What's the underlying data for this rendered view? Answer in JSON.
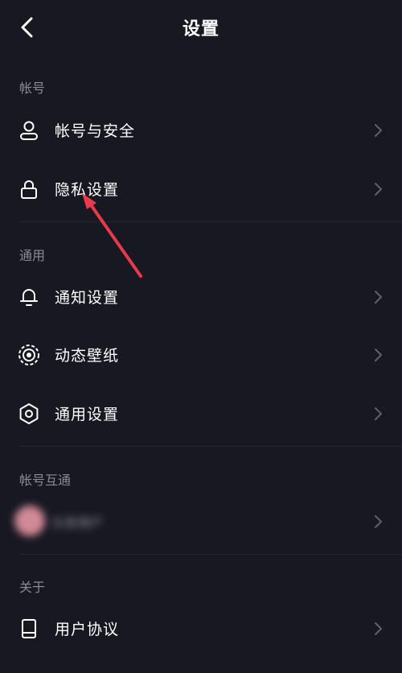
{
  "header": {
    "title": "设置",
    "back_icon": "chevron-left-icon"
  },
  "sections": {
    "account": {
      "label": "帐号",
      "items": [
        {
          "label": "帐号与安全",
          "icon": "user-icon"
        },
        {
          "label": "隐私设置",
          "icon": "lock-icon"
        }
      ]
    },
    "general": {
      "label": "通用",
      "items": [
        {
          "label": "通知设置",
          "icon": "bell-icon"
        },
        {
          "label": "动态壁纸",
          "icon": "live-wallpaper-icon"
        },
        {
          "label": "通用设置",
          "icon": "gear-icon"
        }
      ]
    },
    "linked": {
      "label": "帐号互通",
      "items": [
        {
          "label": "头条用户",
          "icon": "avatar"
        }
      ]
    },
    "about": {
      "label": "关于",
      "items": [
        {
          "label": "用户协议",
          "icon": "book-icon"
        }
      ]
    }
  },
  "colors": {
    "background": "#171822",
    "text_primary": "#ffffff",
    "text_secondary": "#8a8b93",
    "chevron": "#5e606b",
    "annotation_arrow": "#e83a4a"
  }
}
